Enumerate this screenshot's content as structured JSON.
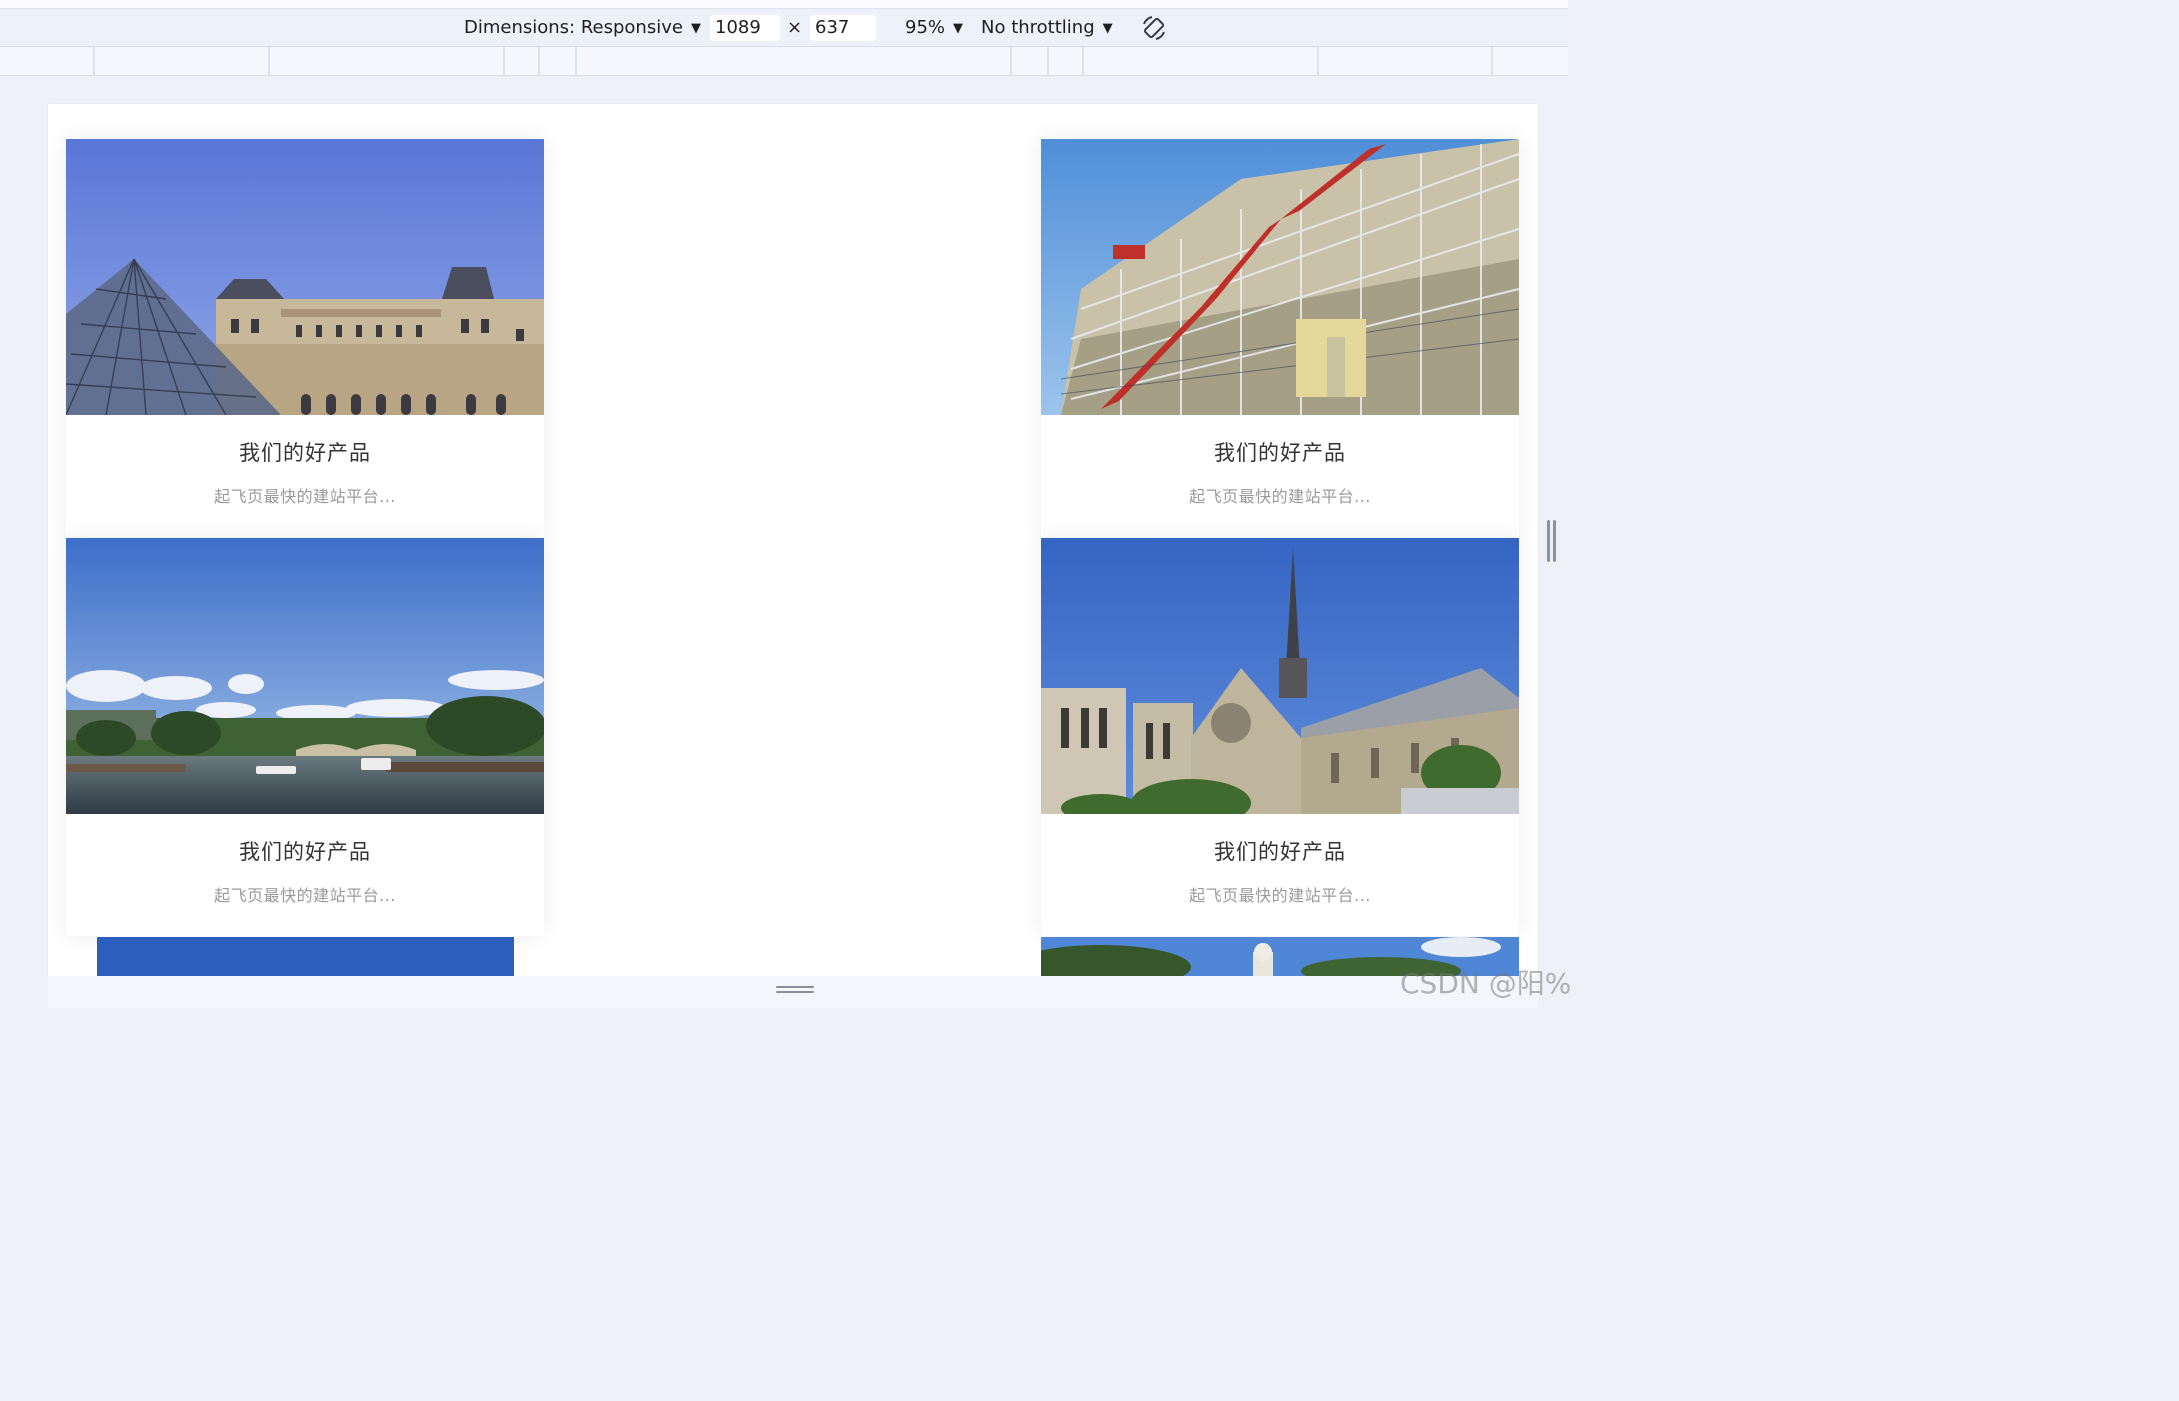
{
  "toolbar": {
    "dimensions_label": "Dimensions: Responsive",
    "width_value": "1089",
    "times_symbol": "×",
    "height_value": "637",
    "zoom": "95%",
    "throttling": "No throttling",
    "rotate_icon": "rotate-icon"
  },
  "cards": [
    {
      "title": "我们的好产品",
      "subtitle": "起飞页最快的建站平台...",
      "image": "louvre-pyramid-photo"
    },
    {
      "title": "我们的好产品",
      "subtitle": "起飞页最快的建站平台...",
      "image": "pompidou-center-photo"
    },
    {
      "title": "我们的好产品",
      "subtitle": "起飞页最快的建站平台...",
      "image": "seine-river-photo"
    },
    {
      "title": "我们的好产品",
      "subtitle": "起飞页最快的建站平台...",
      "image": "notre-dame-photo"
    }
  ],
  "watermark": "CSDN @阳%",
  "colors": {
    "devtools_bg": "#edf1f9",
    "page_bg": "#ffffff",
    "title_text": "#333333",
    "subtitle_text": "#9a9a9a"
  }
}
